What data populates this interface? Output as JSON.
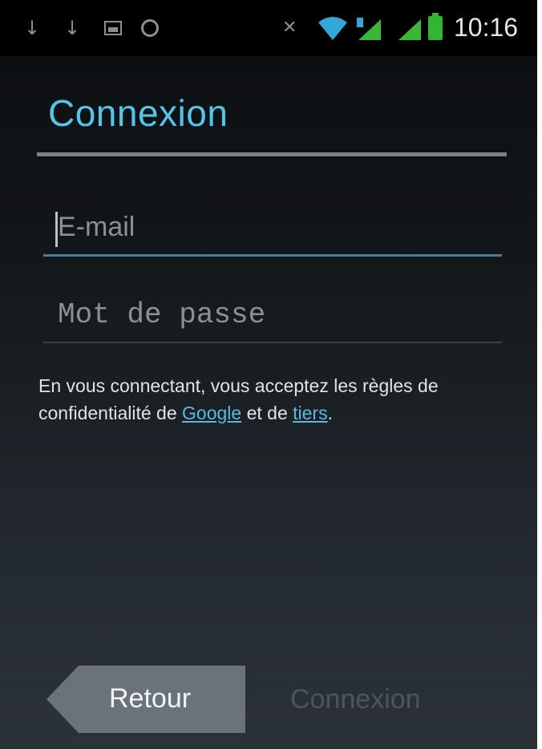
{
  "status_bar": {
    "time": "10:16",
    "icons": [
      "usb-icon",
      "usb-icon",
      "image-icon",
      "globe-icon",
      "muted-icon",
      "wifi-icon",
      "signal-icon",
      "signal-icon",
      "battery-icon"
    ],
    "battery_color": "#33b533"
  },
  "screen": {
    "title": "Connexion",
    "accent_color": "#53c5e8"
  },
  "form": {
    "email": {
      "value": "",
      "placeholder": "E-mail"
    },
    "password": {
      "value": "",
      "placeholder": "Mot de passe"
    }
  },
  "legal": {
    "text_before": " En vous connectant, vous acceptez les règles de confidentialité de ",
    "link_google": "Google",
    "text_middle": " et de ",
    "link_tiers": "tiers",
    "text_after": "."
  },
  "buttons": {
    "back_label": "Retour",
    "connect_label": "Connexion"
  }
}
